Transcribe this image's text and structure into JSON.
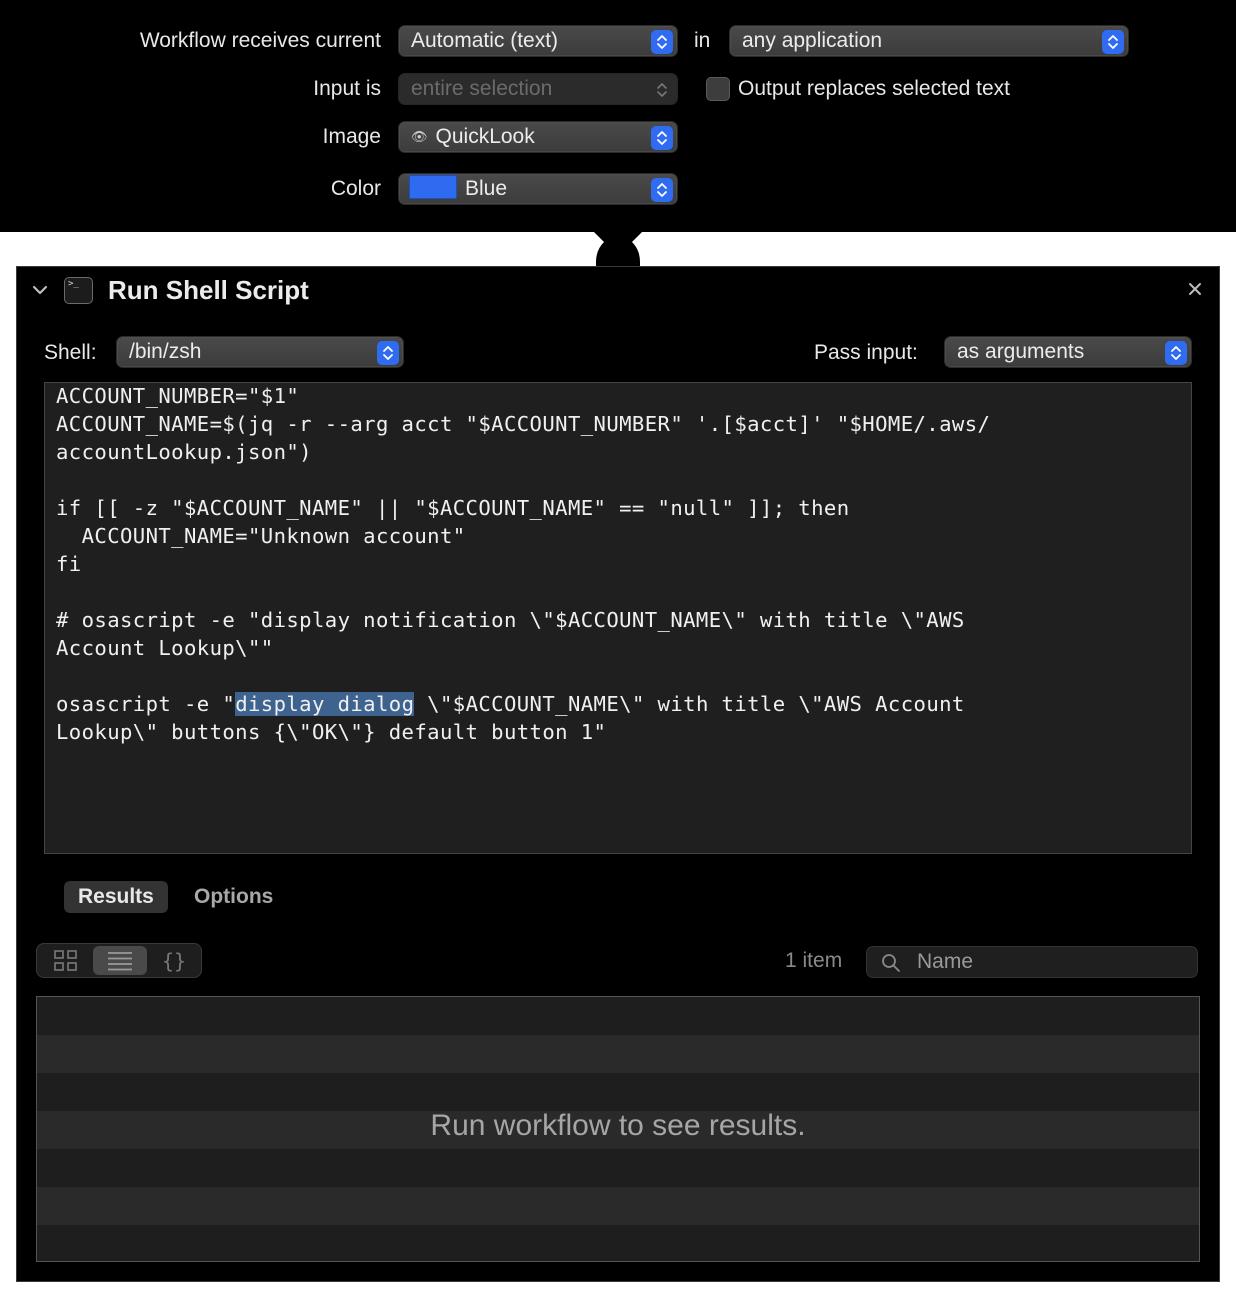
{
  "header": {
    "receives_label": "Workflow receives current",
    "receives_value": "Automatic (text)",
    "in_label": "in",
    "application_value": "any application",
    "input_is_label": "Input is",
    "input_is_value": "entire selection",
    "output_replaces_label": "Output replaces selected text",
    "output_replaces_checked": false,
    "image_label": "Image",
    "image_value": "QuickLook",
    "image_icon": "eye-icon",
    "color_label": "Color",
    "color_value": "Blue",
    "color_swatch": "#2e6bf0"
  },
  "action": {
    "title": "Run Shell Script",
    "shell_label": "Shell:",
    "shell_value": "/bin/zsh",
    "pass_input_label": "Pass input:",
    "pass_input_value": "as arguments",
    "script_lines": [
      "ACCOUNT_NUMBER=\"$1\"",
      "ACCOUNT_NAME=$(jq -r --arg acct \"$ACCOUNT_NUMBER\" '.[$acct]' \"$HOME/.aws/",
      "accountLookup.json\")",
      "",
      "if [[ -z \"$ACCOUNT_NAME\" || \"$ACCOUNT_NAME\" == \"null\" ]]; then",
      "  ACCOUNT_NAME=\"Unknown account\"",
      "fi",
      "",
      "# osascript -e \"display notification \\\"$ACCOUNT_NAME\\\" with title \\\"AWS",
      "Account Lookup\\\"\"",
      "",
      "osascript -e \"",
      "Lookup\\\" buttons {\\\"OK\\\"} default button 1\""
    ],
    "script_line_12_highlight": "display dialog",
    "script_line_12_rest": " \\\"$ACCOUNT_NAME\\\" with title \\\"AWS Account",
    "tabs": [
      "Results",
      "Options"
    ],
    "active_tab": "Results",
    "item_count": "1 item",
    "search_placeholder": "Name",
    "results_empty_text": "Run workflow to see results."
  },
  "colors": {
    "accent": "#2f6cf2",
    "background": "#000000",
    "editor_bg": "#1f1f1f",
    "selection": "#3f638f"
  }
}
